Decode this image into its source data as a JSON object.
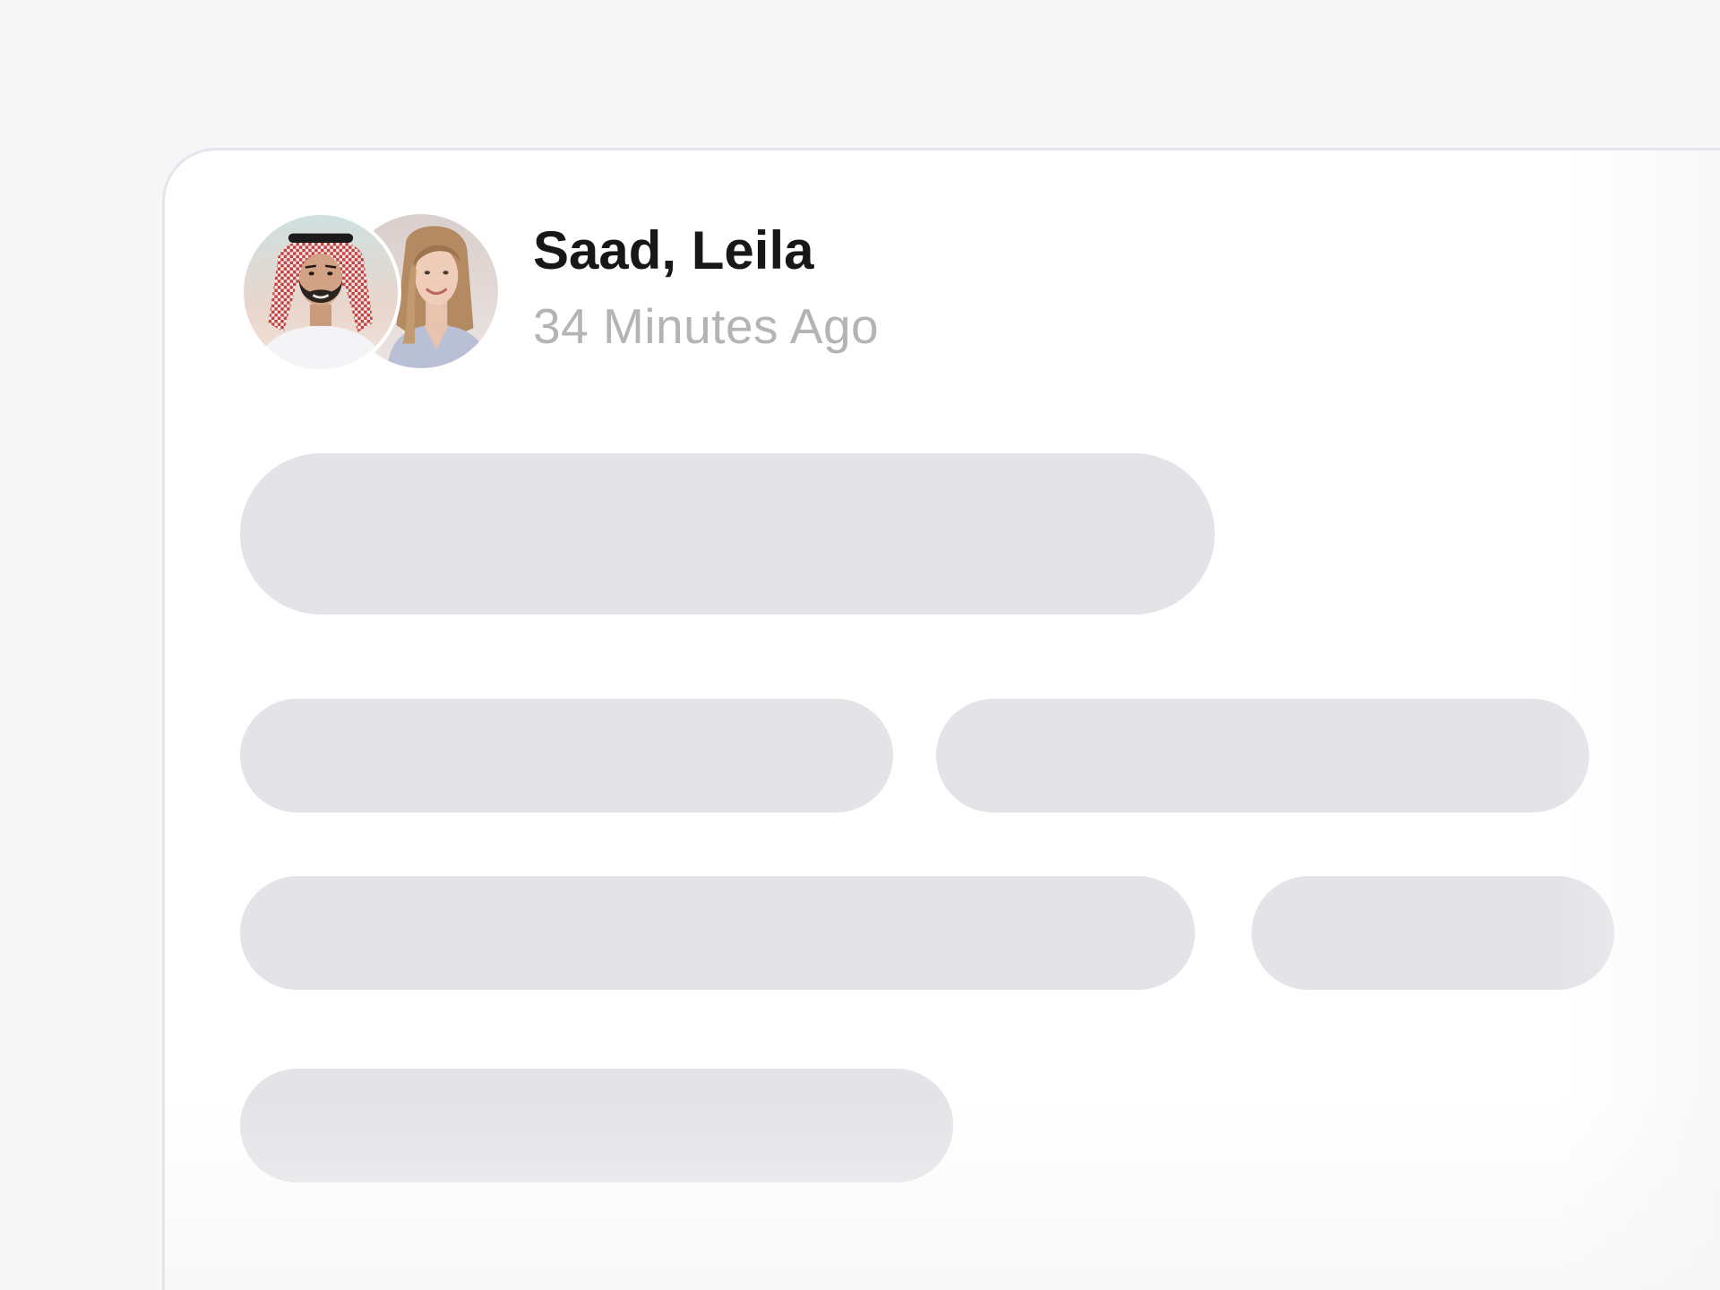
{
  "post": {
    "author_names": "Saad, Leila",
    "timestamp": "34 Minutes Ago",
    "avatars": [
      {
        "icon": "avatar-man-ghutra",
        "person": "Saad"
      },
      {
        "icon": "avatar-woman",
        "person": "Leila"
      }
    ],
    "content_state": "loading-skeleton"
  },
  "colors": {
    "page_background": "#f6f6f7",
    "card_background": "#ffffff",
    "card_border": "#e2e5ec",
    "skeleton": "#e4e4e8",
    "name_text": "#171717",
    "timestamp_text": "#b4b4b7"
  }
}
